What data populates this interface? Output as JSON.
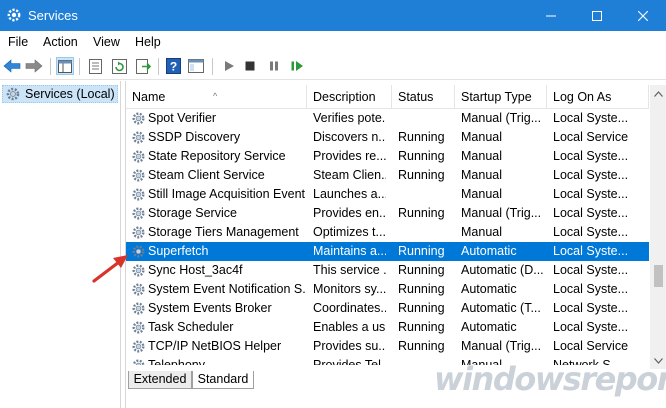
{
  "window": {
    "title": "Services",
    "accent": "#1f7fd7"
  },
  "menu": [
    "File",
    "Action",
    "View",
    "Help"
  ],
  "toolbar_icons": [
    "back-arrow-icon",
    "forward-arrow-icon",
    "show-tree-icon",
    "properties-icon",
    "refresh-icon",
    "export-icon",
    "help-icon",
    "console-icon",
    "play-icon",
    "stop-icon",
    "pause-icon",
    "restart-icon"
  ],
  "tree": {
    "root_label": "Services (Local)"
  },
  "columns": [
    "Name",
    "Description",
    "Status",
    "Startup Type",
    "Log On As"
  ],
  "services": [
    {
      "name": "Spot Verifier",
      "description": "Verifies pote...",
      "status": "",
      "startup": "Manual (Trig...",
      "logon": "Local Syste..."
    },
    {
      "name": "SSDP Discovery",
      "description": "Discovers n...",
      "status": "Running",
      "startup": "Manual",
      "logon": "Local Service"
    },
    {
      "name": "State Repository Service",
      "description": "Provides re...",
      "status": "Running",
      "startup": "Manual",
      "logon": "Local Syste..."
    },
    {
      "name": "Steam Client Service",
      "description": "Steam Clien...",
      "status": "Running",
      "startup": "Manual",
      "logon": "Local Syste..."
    },
    {
      "name": "Still Image Acquisition Events",
      "description": "Launches a...",
      "status": "",
      "startup": "Manual",
      "logon": "Local Syste..."
    },
    {
      "name": "Storage Service",
      "description": "Provides en...",
      "status": "Running",
      "startup": "Manual (Trig...",
      "logon": "Local Syste..."
    },
    {
      "name": "Storage Tiers Management",
      "description": "Optimizes t...",
      "status": "",
      "startup": "Manual",
      "logon": "Local Syste..."
    },
    {
      "name": "Superfetch",
      "description": "Maintains a...",
      "status": "Running",
      "startup": "Automatic",
      "logon": "Local Syste..."
    },
    {
      "name": "Sync Host_3ac4f",
      "description": "This service ...",
      "status": "Running",
      "startup": "Automatic (D...",
      "logon": "Local Syste..."
    },
    {
      "name": "System Event Notification S...",
      "description": "Monitors sy...",
      "status": "Running",
      "startup": "Automatic",
      "logon": "Local Syste..."
    },
    {
      "name": "System Events Broker",
      "description": "Coordinates...",
      "status": "Running",
      "startup": "Automatic (T...",
      "logon": "Local Syste..."
    },
    {
      "name": "Task Scheduler",
      "description": "Enables a us...",
      "status": "Running",
      "startup": "Automatic",
      "logon": "Local Syste..."
    },
    {
      "name": "TCP/IP NetBIOS Helper",
      "description": "Provides su...",
      "status": "Running",
      "startup": "Manual (Trig...",
      "logon": "Local Service"
    },
    {
      "name": "Telephony",
      "description": "Provides Tel...",
      "status": "",
      "startup": "Manual",
      "logon": "Network S..."
    }
  ],
  "tabs": [
    "Extended",
    "Standard"
  ],
  "watermark": "windowsreport"
}
